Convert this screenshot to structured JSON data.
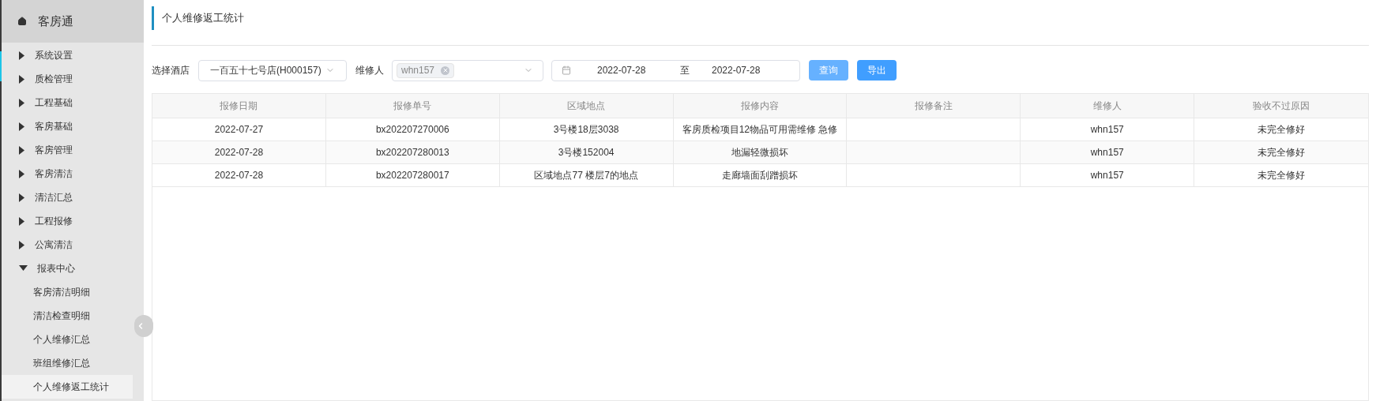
{
  "sidebar": {
    "title": "客房通",
    "items": [
      {
        "label": "系统设置",
        "expanded": false
      },
      {
        "label": "质检管理",
        "expanded": false
      },
      {
        "label": "工程基础",
        "expanded": false
      },
      {
        "label": "客房基础",
        "expanded": false
      },
      {
        "label": "客房管理",
        "expanded": false
      },
      {
        "label": "客房清洁",
        "expanded": false
      },
      {
        "label": "清洁汇总",
        "expanded": false
      },
      {
        "label": "工程报修",
        "expanded": false
      },
      {
        "label": "公寓清洁",
        "expanded": false
      },
      {
        "label": "报表中心",
        "expanded": true,
        "children": [
          {
            "label": "客房清洁明细",
            "selected": false
          },
          {
            "label": "清洁检查明细",
            "selected": false
          },
          {
            "label": "个人维修汇总",
            "selected": false
          },
          {
            "label": "班组维修汇总",
            "selected": false
          },
          {
            "label": "个人维修返工统计",
            "selected": true
          }
        ]
      }
    ]
  },
  "page_title": "个人维修返工统计",
  "filters": {
    "hotel_label": "选择酒店",
    "hotel_value": "一百五十七号店(H000157)",
    "repairer_label": "维修人",
    "repairer_tag": "whn157",
    "date_start": "2022-07-28",
    "date_separator": "至",
    "date_end": "2022-07-28"
  },
  "buttons": [
    {
      "label": "查询",
      "disabled": true
    },
    {
      "label": "导出",
      "disabled": false
    }
  ],
  "table": {
    "columns": [
      "报修日期",
      "报修单号",
      "区域地点",
      "报修内容",
      "报修备注",
      "维修人",
      "验收不过原因"
    ],
    "rows": [
      [
        "2022-07-27",
        "bx202207270006",
        "3号楼18层3038",
        "客房质检项目12物品可用需维修 急修",
        "",
        "whn157",
        "未完全修好"
      ],
      [
        "2022-07-28",
        "bx202207280013",
        "3号楼152004",
        "地漏轻微损坏",
        "",
        "whn157",
        "未完全修好"
      ],
      [
        "2022-07-28",
        "bx202207280017",
        "区域地点77 楼层7的地点",
        "走廊墙面刮蹭损坏",
        "",
        "whn157",
        "未完全修好"
      ]
    ]
  }
}
